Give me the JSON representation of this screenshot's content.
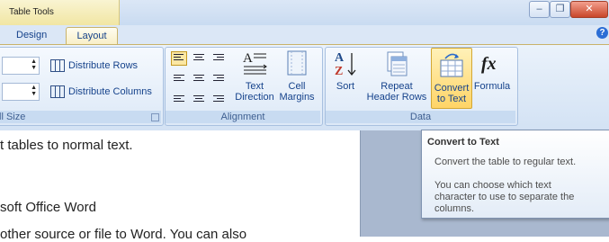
{
  "title_bar": {
    "contextual_tab": "Table Tools",
    "minimize": "–",
    "restore": "❐",
    "close": "✕"
  },
  "tabs": {
    "design": "Design",
    "layout": "Layout",
    "help": "?"
  },
  "cell_size_group": {
    "label": "ll Size",
    "distribute_rows": "Distribute Rows",
    "distribute_columns": "Distribute Columns"
  },
  "alignment_group": {
    "label": "Alignment",
    "text_direction": [
      "Text",
      "Direction"
    ],
    "cell_margins": [
      "Cell",
      "Margins"
    ]
  },
  "data_group": {
    "label": "Data",
    "sort": "Sort",
    "repeat_header_rows": [
      "Repeat",
      "Header Rows"
    ],
    "convert_to_text": [
      "Convert",
      "to Text"
    ],
    "formula": "Formula",
    "sort_icon_letters": [
      "A",
      "Z"
    ],
    "formula_icon": "fx"
  },
  "document": {
    "line1": "t tables to normal text.",
    "line2": "soft Office Word",
    "line3": "other source or file to Word. You can also"
  },
  "tooltip": {
    "title": "Convert to Text",
    "line1": "Convert the table to regular text.",
    "line2": "You can choose which text",
    "line3": "character to use to separate the",
    "line4": "columns."
  },
  "colors": {
    "accent": "#15428b",
    "highlight": "#ffd467",
    "ribbon": "#dbe7f6"
  }
}
